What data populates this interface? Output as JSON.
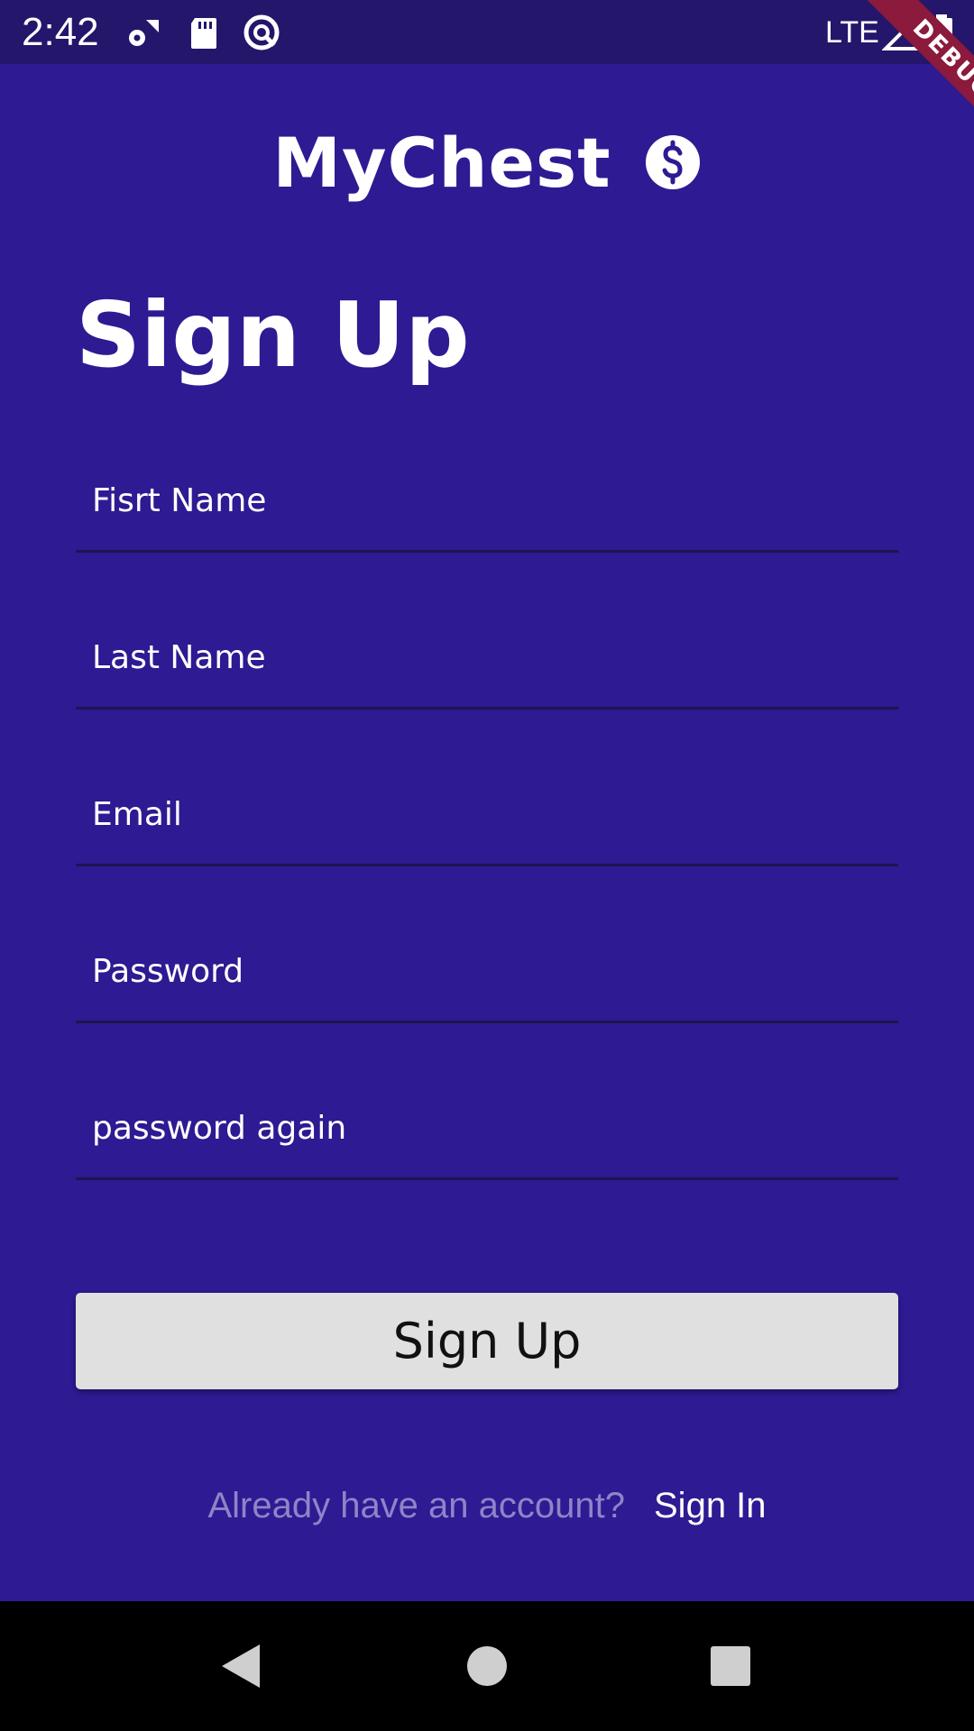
{
  "status_bar": {
    "time": "2:42",
    "network": "LTE",
    "icons": [
      "settings-icon",
      "sd-card-icon",
      "data-saver-icon",
      "signal-icon",
      "battery-icon"
    ]
  },
  "debug_banner": "DEBUG",
  "app": {
    "title": "MyChest",
    "logo_icon": "dollar-circle-icon"
  },
  "page": {
    "title": "Sign Up"
  },
  "form": {
    "first_name_placeholder": "Fisrt Name",
    "last_name_placeholder": "Last Name",
    "email_placeholder": "Email",
    "password_placeholder": "Password",
    "password_again_placeholder": "password again",
    "submit_label": "Sign Up"
  },
  "signin": {
    "prompt": "Already have an account?",
    "link": "Sign In"
  },
  "nav_bar": {
    "icons": [
      "back-icon",
      "home-icon",
      "recents-icon"
    ]
  },
  "colors": {
    "background": "#2E1A92",
    "status_bar": "#24166B",
    "button": "#E0E0E0",
    "debug_banner": "#8B1A3C",
    "muted_text": "#8E84C8"
  }
}
